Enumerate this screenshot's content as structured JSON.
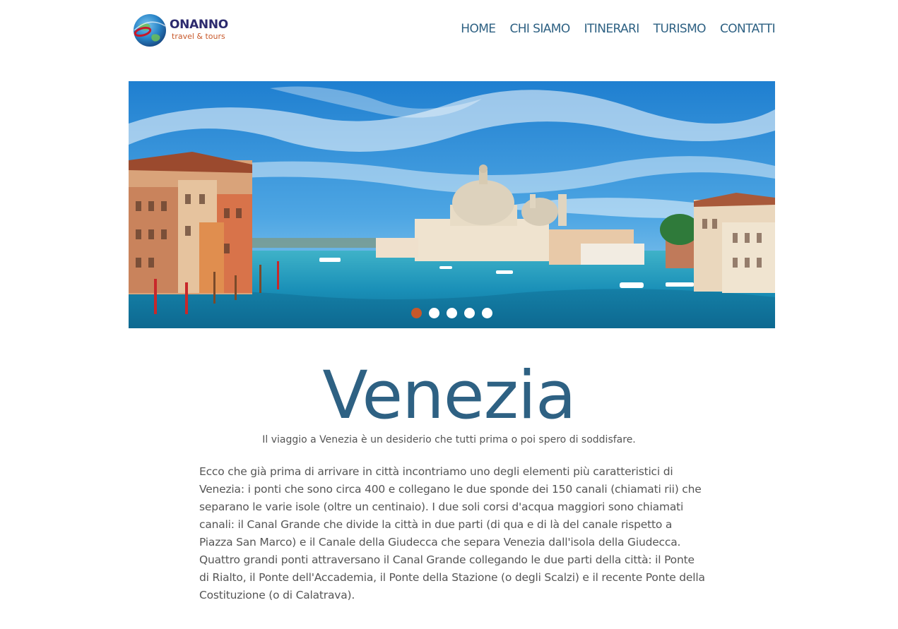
{
  "logo": {
    "brand": "ONANNO",
    "tagline": "travel & tours"
  },
  "nav": {
    "items": [
      "HOME",
      "CHI SIAMO",
      "ITINERARI",
      "TURISMO",
      "CONTATTI"
    ]
  },
  "slider": {
    "slide_count": 5,
    "active_index": 0
  },
  "content": {
    "title": "Venezia",
    "subtitle": "Il viaggio a Venezia è un desiderio che tutti prima o poi spero di soddisfare.",
    "paragraph": "Ecco che già prima di arrivare in città incontriamo uno degli elementi più caratteristici di Venezia: i ponti che sono circa 400 e collegano le due sponde dei 150 canali (chiamati rii) che separano le varie isole (oltre un centinaio). I due soli corsi d'acqua maggiori sono chiamati canali: il Canal Grande che divide la città in due parti (di qua e di là del canale rispetto a Piazza San Marco) e il Canale della Giudecca che separa Venezia dall'isola della Giudecca. Quattro grandi ponti attraversano il Canal Grande collegando le due parti della città: il Ponte di Rialto, il Ponte dell'Accademia, il Ponte della Stazione (o degli Scalzi) e il recente Ponte della Costituzione (o di Calatrava)."
  },
  "colors": {
    "nav_text": "#2e6183",
    "title": "#2e6183",
    "accent": "#c8582a",
    "body_text": "#555555"
  },
  "icons": {
    "logo": "globe-icon"
  }
}
